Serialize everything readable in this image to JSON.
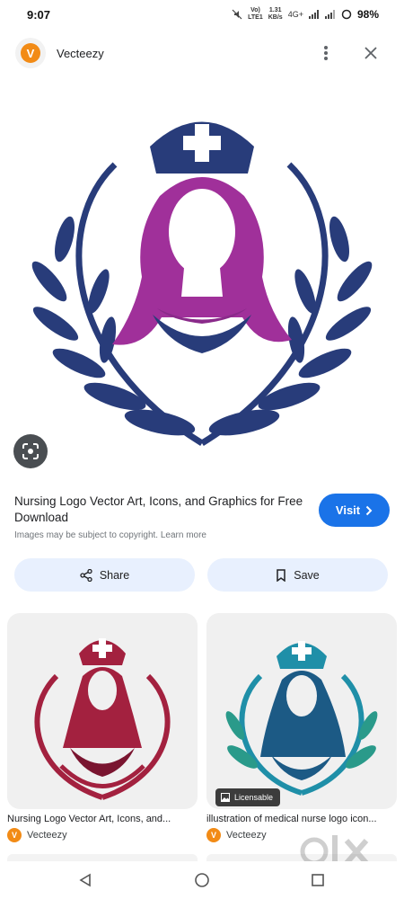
{
  "status": {
    "time": "9:07",
    "volte": "Vo)",
    "lte": "LTE1",
    "speed_value": "1.31",
    "speed_unit": "KB/s",
    "network": "4G+",
    "battery": "98%"
  },
  "header": {
    "site_name": "Vecteezy",
    "logo_letter": "V"
  },
  "hero": {
    "image": "nursing-logo-nurse-with-purple-hair-and-laurel",
    "colors": {
      "navy": "#283c7a",
      "purple": "#a0309a",
      "orange": "#f28b16"
    }
  },
  "result": {
    "title": "Nursing Logo Vector Art, Icons, and Graphics for Free Download",
    "copyright": "Images may be subject to copyright. Learn more",
    "visit_label": "Visit"
  },
  "actions": {
    "share_label": "Share",
    "save_label": "Save"
  },
  "related": [
    {
      "caption": "Nursing Logo Vector Art, Icons, and...",
      "source": "Vecteezy",
      "badge": ""
    },
    {
      "caption": "illustration of medical nurse logo icon...",
      "source": "Vecteezy",
      "badge": "Licensable"
    }
  ],
  "watermark": "olx",
  "accent": "#1a73e8"
}
